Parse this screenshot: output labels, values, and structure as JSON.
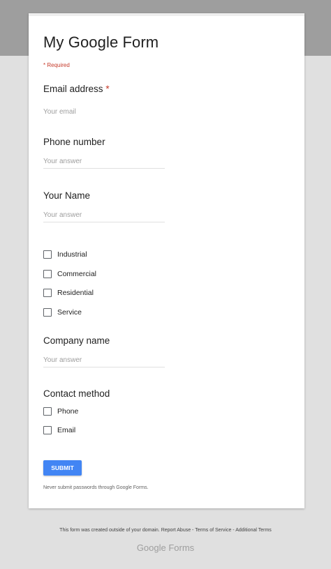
{
  "form": {
    "title": "My Google Form",
    "required_note": "* Required",
    "email": {
      "label": "Email address",
      "required_marker": "*",
      "placeholder": "Your email"
    },
    "phone": {
      "label": "Phone number",
      "placeholder": "Your answer"
    },
    "name": {
      "label": "Your Name",
      "placeholder": "Your answer"
    },
    "category_options": [
      "Industrial",
      "Commercial",
      "Residential",
      "Service"
    ],
    "company": {
      "label": "Company name",
      "placeholder": "Your answer"
    },
    "contact_method": {
      "label": "Contact method",
      "options": [
        "Phone",
        "Email"
      ]
    },
    "submit_label": "SUBMIT",
    "password_note": "Never submit passwords through Google Forms."
  },
  "footer": {
    "notice": "This form was created outside of your domain.",
    "links": [
      "Report Abuse",
      "Terms of Service",
      "Additional Terms"
    ],
    "separator": " - ",
    "brand": "Google Forms"
  },
  "colors": {
    "accent": "#4285f4",
    "required": "#c53929",
    "header_band": "#9e9e9e",
    "page_background": "#e0e0e0"
  },
  "icons": {
    "checkbox": "checkbox-unchecked-icon"
  }
}
